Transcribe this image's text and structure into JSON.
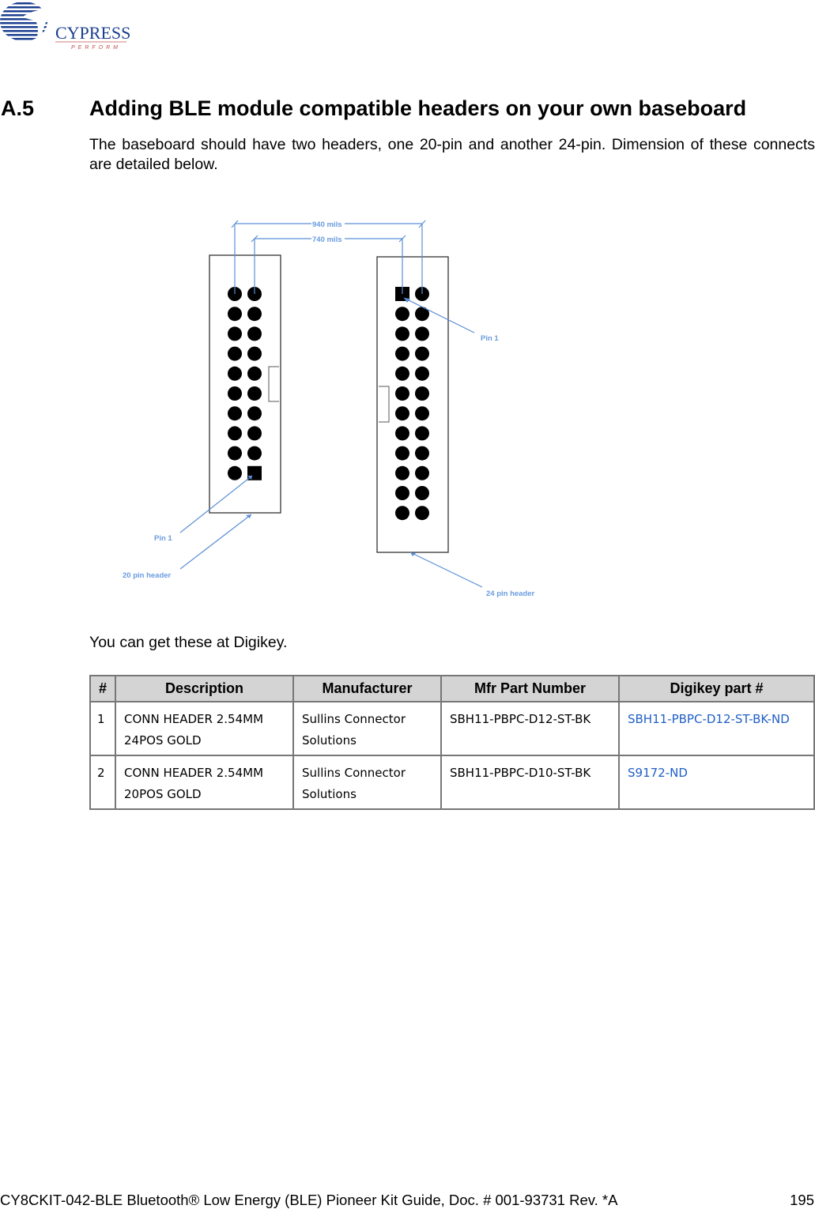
{
  "logo": {
    "brand": "CYPRESS",
    "tagline": "PERFORM"
  },
  "section": {
    "number": "A.5",
    "title": "Adding BLE module compatible headers on your own baseboard"
  },
  "intro": "The baseboard should have two headers, one 20-pin and another 24-pin. Dimension of these connects are detailed below.",
  "diagram": {
    "dim_outer": "940 mils",
    "dim_inner": "740 mils",
    "pin1_right": "Pin 1",
    "pin1_left": "Pin 1",
    "label_20": "20 pin header",
    "label_24": "24 pin header",
    "line_color": "#5b8fd6"
  },
  "digikey_note": "You can get these at Digikey.",
  "table": {
    "headers": [
      "#",
      "Description",
      "Manufacturer",
      "Mfr Part Number",
      "Digikey part #"
    ],
    "rows": [
      {
        "num": "1",
        "desc1": "CONN HEADER 2.54MM",
        "desc2": "24POS GOLD",
        "mfr1": "Sullins Connector",
        "mfr2": "Solutions",
        "part": "SBH11-PBPC-D12-ST-BK",
        "digikey": "SBH11-PBPC-D12-ST-BK-ND"
      },
      {
        "num": "2",
        "desc1": "CONN HEADER 2.54MM",
        "desc2": "20POS GOLD",
        "mfr1": "Sullins Connector",
        "mfr2": "Solutions",
        "part": "SBH11-PBPC-D10-ST-BK",
        "digikey": "S9172-ND"
      }
    ]
  },
  "footer": {
    "doc": "CY8CKIT-042-BLE Bluetooth® Low Energy (BLE) Pioneer Kit Guide, Doc. # 001-93731 Rev. *A",
    "page": "195"
  }
}
